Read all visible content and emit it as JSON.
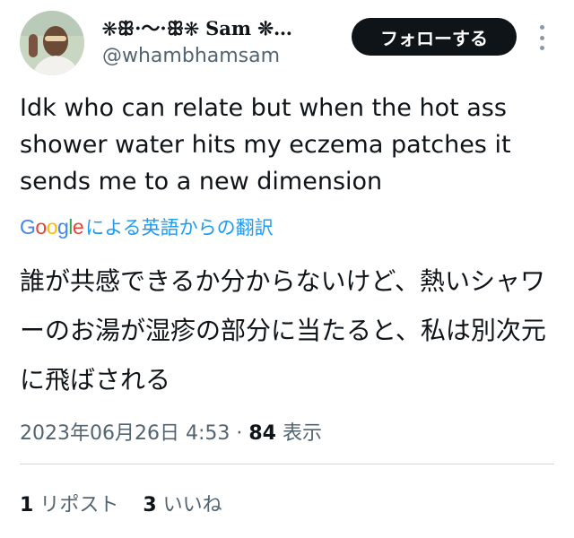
{
  "author": {
    "display_name": "❊ꕥ·〜·ꕥ❊ Sam ❊…",
    "handle": "@whambhamsam",
    "avatar_icon": "profile-avatar"
  },
  "follow_button": {
    "label": "フォローする"
  },
  "tweet": {
    "text": "Idk who can relate but when the hot ass shower water hits my eczema patches it sends me to a new dimension"
  },
  "translation": {
    "logo": "Google",
    "label": "による英語からの翻訳",
    "text": "誰が共感できるか分からないけど、熱いシャワーのお湯が湿疹の部分に当たると、私は別次元に飛ばされる"
  },
  "meta": {
    "datetime": "2023年06月26日 4:53",
    "separator": "·",
    "views_count": "84",
    "views_label": "表示"
  },
  "engagement": {
    "reposts_count": "1",
    "reposts_label": "リポスト",
    "likes_count": "3",
    "likes_label": "いいね"
  },
  "colors": {
    "text": "#0f1419",
    "secondary": "#536471",
    "link": "#1d9bf0",
    "follow_bg": "#0f1419",
    "divider": "#cfd9de"
  }
}
